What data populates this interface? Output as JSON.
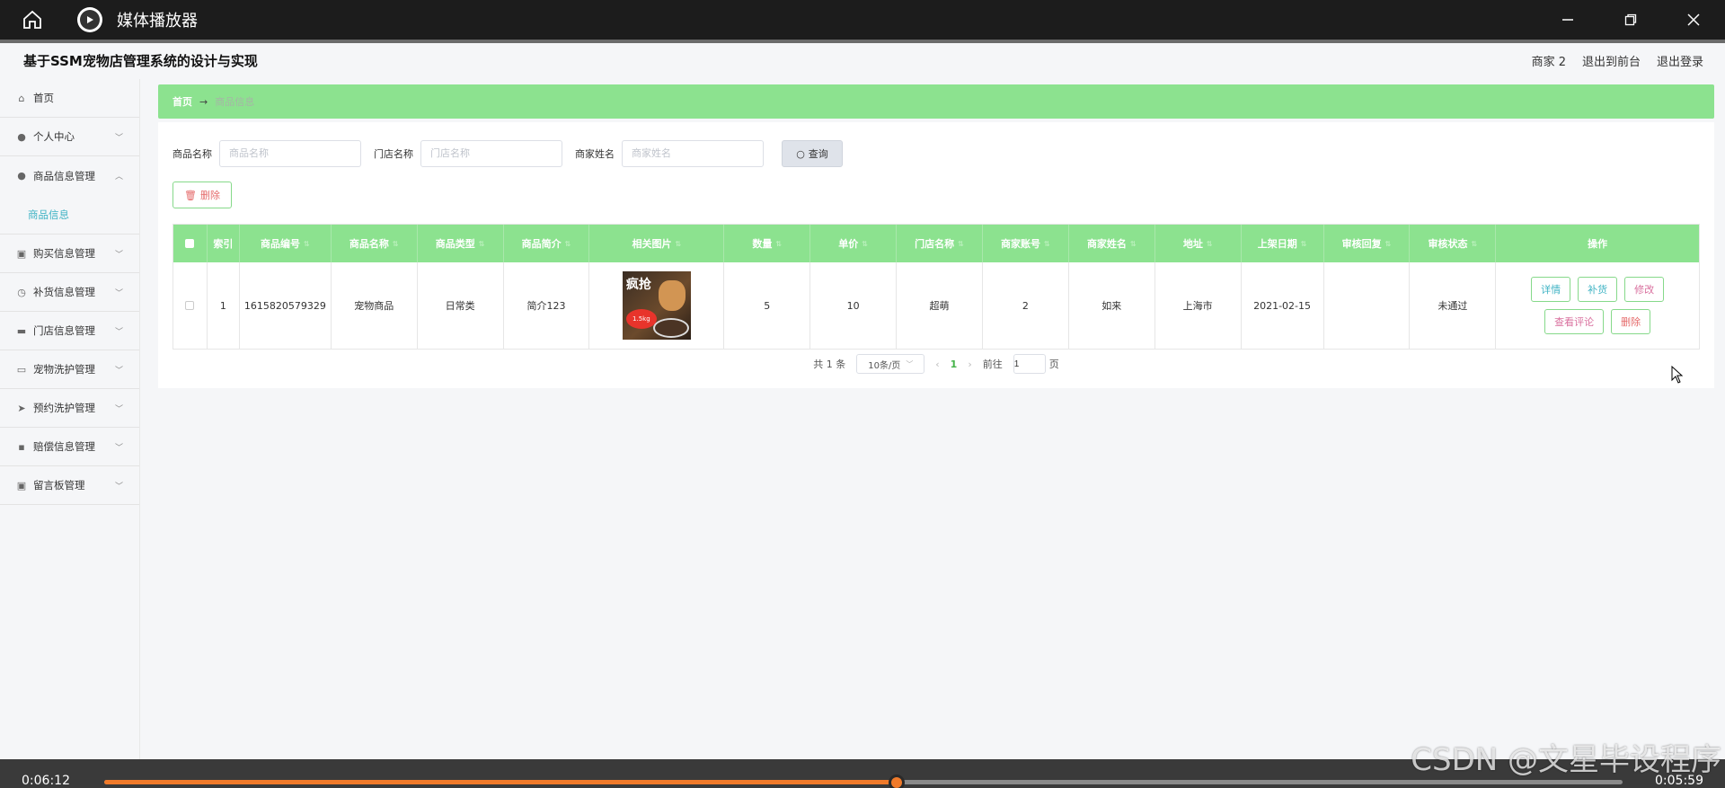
{
  "player": {
    "title": "媒体播放器",
    "time_elapsed": "0:06:12",
    "time_remaining": "0:05:59",
    "progress": 0.522,
    "colors": {
      "accent": "#f07a2a",
      "bar": "#1c1c1c"
    }
  },
  "app": {
    "title": "基于SSM宠物店管理系统的设计与实现",
    "user": "商家 2",
    "back_to_front": "退出到前台",
    "logout": "退出登录"
  },
  "sidebar": {
    "items": [
      {
        "label": "首页",
        "icon": "home-icon"
      },
      {
        "label": "个人中心",
        "icon": "user-icon"
      },
      {
        "label": "商品信息管理",
        "icon": "user-icon",
        "open": true,
        "sub": "商品信息"
      },
      {
        "label": "购买信息管理",
        "icon": "clipboard-icon"
      },
      {
        "label": "补货信息管理",
        "icon": "clock-icon"
      },
      {
        "label": "门店信息管理",
        "icon": "chat-icon"
      },
      {
        "label": "宠物洗护管理",
        "icon": "card-icon"
      },
      {
        "label": "预约洗护管理",
        "icon": "send-icon"
      },
      {
        "label": "赔偿信息管理",
        "icon": "briefcase-icon"
      },
      {
        "label": "留言板管理",
        "icon": "clipboard-icon"
      }
    ]
  },
  "breadcrumb": {
    "home": "首页",
    "separator": "→",
    "current": "商品信息"
  },
  "search": {
    "product_name_label": "商品名称",
    "product_name_placeholder": "商品名称",
    "store_name_label": "门店名称",
    "store_name_placeholder": "门店名称",
    "merchant_name_label": "商家姓名",
    "merchant_name_placeholder": "商家姓名",
    "button": "查询"
  },
  "toolbar": {
    "delete": "删除"
  },
  "table": {
    "headers": [
      "索引",
      "商品编号",
      "商品名称",
      "商品类型",
      "商品简介",
      "相关图片",
      "数量",
      "单价",
      "门店名称",
      "商家账号",
      "商家姓名",
      "地址",
      "上架日期",
      "审核回复",
      "审核状态",
      "操作"
    ],
    "rows": [
      {
        "index": "1",
        "code": "1615820579329",
        "name": "宠物商品",
        "type": "日常类",
        "intro": "简介123",
        "image_title": "疯抢",
        "image_badge": "1.5kg",
        "qty": "5",
        "price": "10",
        "store": "超萌",
        "merchant_account": "2",
        "merchant_name": "如来",
        "address": "上海市",
        "date": "2021-02-15",
        "reply": "",
        "status": "未通过",
        "ops": {
          "detail": "详情",
          "restock": "补货",
          "edit": "修改",
          "review": "查看评论",
          "delete": "删除"
        }
      }
    ]
  },
  "pagination": {
    "total": "共 1 条",
    "page_size": "10条/页",
    "current": "1",
    "goto_label": "前往",
    "goto_value": "1",
    "page_suffix": "页"
  },
  "watermark": "CSDN @文星毕设程序",
  "colors": {
    "header_green": "#8ce28f",
    "link_teal": "#3fb3c4",
    "danger": "#e56b6b"
  }
}
